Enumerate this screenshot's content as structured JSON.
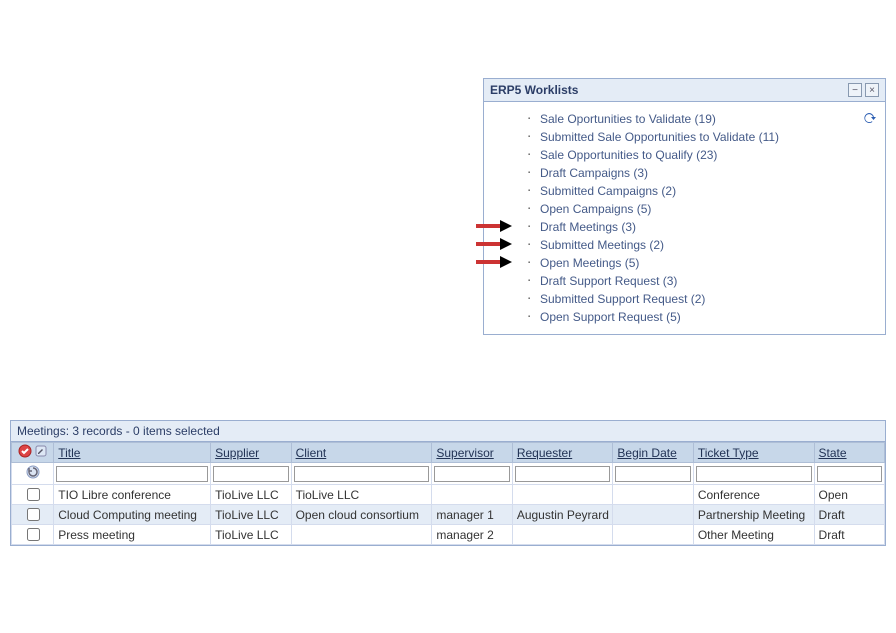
{
  "worklists": {
    "title": "ERP5 Worklists",
    "items": [
      {
        "label": "Sale Oportunities to Validate (19)",
        "arrow": false
      },
      {
        "label": "Submitted Sale Opportunities to Validate (11)",
        "arrow": false
      },
      {
        "label": "Sale Opportunities to Qualify (23)",
        "arrow": false
      },
      {
        "label": "Draft Campaigns (3)",
        "arrow": false
      },
      {
        "label": "Submitted Campaigns (2)",
        "arrow": false
      },
      {
        "label": "Open Campaigns (5)",
        "arrow": false
      },
      {
        "label": "Draft Meetings (3)",
        "arrow": true
      },
      {
        "label": "Submitted Meetings (2)",
        "arrow": true
      },
      {
        "label": "Open Meetings (5)",
        "arrow": true
      },
      {
        "label": "Draft Support Request (3)",
        "arrow": false
      },
      {
        "label": "Submitted Support Request (2)",
        "arrow": false
      },
      {
        "label": "Open Support Request (5)",
        "arrow": false
      }
    ]
  },
  "table": {
    "caption": "Meetings: 3 records - 0 items selected",
    "columns": {
      "title": "Title",
      "supplier": "Supplier",
      "client": "Client",
      "supervisor": "Supervisor",
      "requester": "Requester",
      "begin_date": "Begin Date",
      "ticket_type": "Ticket Type",
      "state": "State"
    },
    "rows": [
      {
        "title": "TIO Libre conference",
        "supplier": "TioLive LLC",
        "client": "TioLive LLC",
        "supervisor": "",
        "requester": "",
        "begin_date": "",
        "ticket_type": "Conference",
        "state": "Open"
      },
      {
        "title": "Cloud Computing meeting",
        "supplier": "TioLive LLC",
        "client": "Open cloud consortium",
        "supervisor": "manager 1",
        "requester": "Augustin Peyrard",
        "begin_date": "",
        "ticket_type": "Partnership Meeting",
        "state": "Draft"
      },
      {
        "title": "Press meeting",
        "supplier": "TioLive LLC",
        "client": "",
        "supervisor": "manager 2",
        "requester": "",
        "begin_date": "",
        "ticket_type": "Other Meeting",
        "state": "Draft"
      }
    ]
  }
}
